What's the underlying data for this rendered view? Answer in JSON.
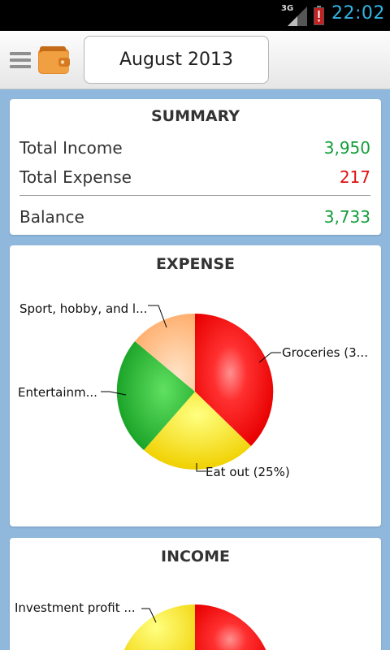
{
  "status_bar": {
    "network": "3G",
    "time": "22:02"
  },
  "app_bar": {
    "month": "August 2013"
  },
  "summary": {
    "title": "SUMMARY",
    "income_label": "Total Income",
    "income_value": "3,950",
    "expense_label": "Total Expense",
    "expense_value": "217",
    "balance_label": "Balance",
    "balance_value": "3,733"
  },
  "expense": {
    "title": "EXPENSE",
    "labels": {
      "groceries": "Groceries (3...",
      "eat_out": "Eat out (25%)",
      "entertainment": "Entertainm...",
      "sport": "Sport, hobby, and l..."
    }
  },
  "income": {
    "title": "INCOME",
    "labels": {
      "investment": "Investment profit ..."
    }
  },
  "colors": {
    "positive": "#119e3a",
    "negative": "#e01010",
    "accent_time": "#33b5e5",
    "background": "#8fb8dc"
  }
}
